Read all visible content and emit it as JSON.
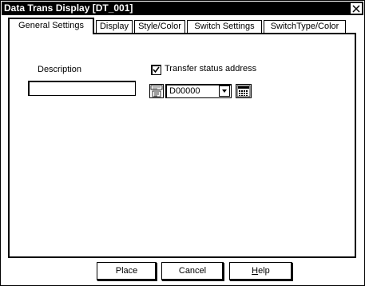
{
  "window": {
    "title": "Data Trans Display [DT_001]"
  },
  "tabs": [
    {
      "label": "General Settings"
    },
    {
      "label": "Display"
    },
    {
      "label": "Style/Color"
    },
    {
      "label": "Switch Settings"
    },
    {
      "label": "SwitchType/Color"
    }
  ],
  "general": {
    "description_label": "Description",
    "description_value": "",
    "transfer_checkbox_label": "Transfer status address",
    "transfer_checked": true,
    "address_value": "D00000"
  },
  "buttons": {
    "place": "Place",
    "cancel": "Cancel",
    "help_prefix": "",
    "help_mnemonic": "H",
    "help_rest": "elp"
  }
}
